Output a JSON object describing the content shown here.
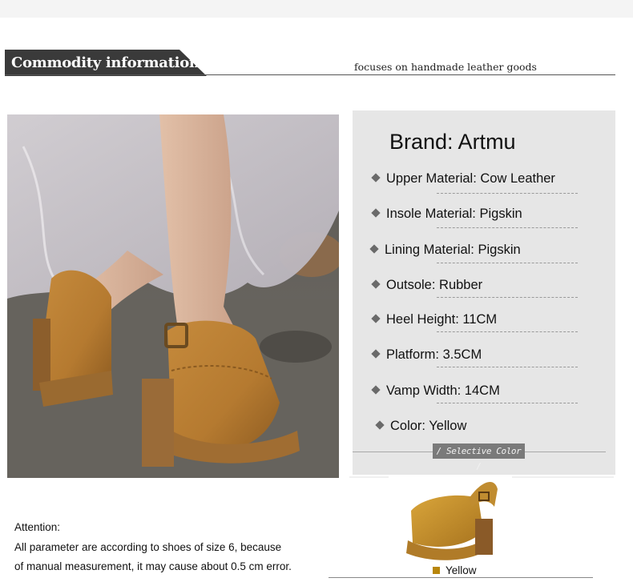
{
  "header": {
    "title": "Commodity information",
    "tagline": "focuses on handmade leather goods"
  },
  "specs": {
    "brand": "Brand:  Artmu",
    "items": [
      "Upper Material: Cow Leather",
      "Insole Material: Pigskin",
      "Lining Material: Pigskin",
      "Outsole: Rubber",
      "Heel Height:  11CM",
      "Platform:  3.5CM",
      "Vamp Width:  14CM",
      "Color:  Yellow"
    ],
    "selective_color": "/ Selective Color /"
  },
  "color_option": {
    "label": "Yellow",
    "swatch": "#b8860b"
  },
  "attention": {
    "heading": "Attention:",
    "line1": "All parameter are according to shoes of size 6, because",
    "line2": "of manual measurement, it may cause about 0.5 cm error."
  },
  "icons": [
    "bullet-diamond-icon"
  ]
}
